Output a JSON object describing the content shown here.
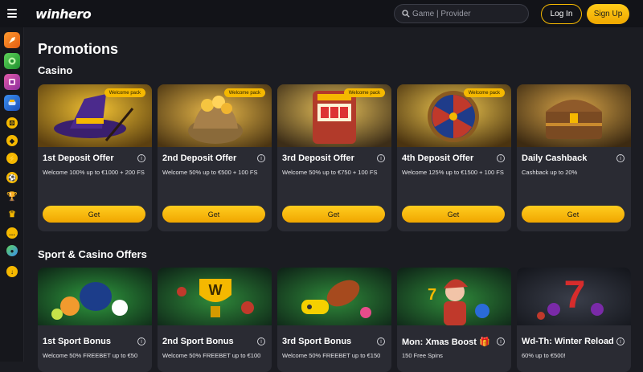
{
  "header": {
    "logo": "winhero",
    "search_placeholder": "Game | Provider",
    "login_label": "Log In",
    "signup_label": "Sign Up"
  },
  "page_title": "Promotions",
  "sections": {
    "casino_title": "Casino",
    "sport_title": "Sport & Casino Offers"
  },
  "casino_cards": [
    {
      "title": "1st Deposit Offer",
      "desc": "Welcome 100% up to €1000 + 200 FS",
      "badge": "Welcome pack",
      "button": "Get"
    },
    {
      "title": "2nd Deposit Offer",
      "desc": "Welcome 50% up to €500 + 100 FS",
      "badge": "Welcome pack",
      "button": "Get"
    },
    {
      "title": "3rd Deposit Offer",
      "desc": "Welcome 50% up to €750 + 100 FS",
      "badge": "Welcome pack",
      "button": "Get"
    },
    {
      "title": "4th Deposit Offer",
      "desc": "Welcome 125% up to €1500 + 100 FS",
      "badge": "Welcome pack",
      "button": "Get"
    },
    {
      "title": "Daily Cashback",
      "desc": "Cashback up to 20%",
      "badge": "",
      "button": "Get"
    }
  ],
  "sport_cards": [
    {
      "title": "1st Sport Bonus",
      "desc": "Welcome 50% FREEBET up to €50"
    },
    {
      "title": "2nd Sport Bonus",
      "desc": "Welcome 50% FREEBET up to €100"
    },
    {
      "title": "3rd Sport Bonus",
      "desc": "Welcome 50% FREEBET up to €150"
    },
    {
      "title": "Mon: Xmas Boost 🎁",
      "desc": "150 Free Spins"
    },
    {
      "title": "Wd-Th: Winter Reload",
      "desc": "60% up to €500!"
    }
  ],
  "info_glyph": "i",
  "colors": {
    "accent": "#f5b800",
    "card": "#2a2b33",
    "bg": "#1b1c22"
  }
}
